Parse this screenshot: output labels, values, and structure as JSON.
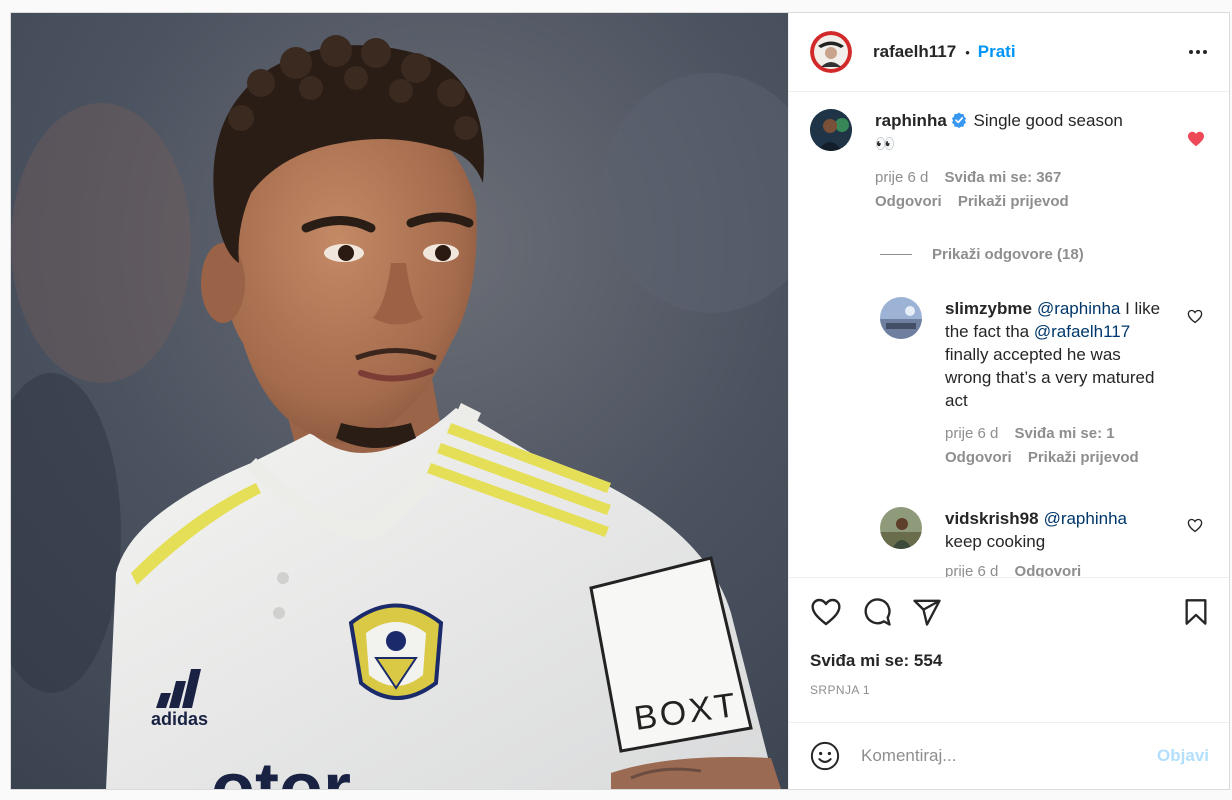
{
  "header": {
    "username": "rafaelh117",
    "separator": "•",
    "follow_label": "Prati"
  },
  "caption_comment": {
    "username": "raphinha",
    "text": "Single good season",
    "emoji": "👀",
    "time": "prije 6 d",
    "likes": "Sviđa mi se: 367",
    "reply_label": "Odgovori",
    "translate_label": "Prikaži prijevod",
    "liked": true
  },
  "view_replies": "Prikaži odgovore (18)",
  "replies": [
    {
      "username": "slimzybme",
      "mention": "@raphinha",
      "text_1": " I like the fact tha ",
      "mention_2": "@rafaelh117",
      "text_2": " finally accepted he was wrong that’s a very matured act",
      "time": "prije 6 d",
      "likes": "Sviđa mi se: 1",
      "reply_label": "Odgovori",
      "translate_label": "Prikaži prijevod"
    },
    {
      "username": "vidskrish98",
      "mention": "@raphinha",
      "text_1": " keep cooking",
      "time": "prije 6 d",
      "reply_label": "Odgovori"
    }
  ],
  "actions": {
    "likes": "Sviđa mi se: 554",
    "date": "SRPNJA 1"
  },
  "comment_box": {
    "placeholder": "Komentiraj...",
    "post_label": "Objavi"
  },
  "photo": {
    "jersey_sponsor": "BOXT",
    "jersey_text": "otor",
    "brand_mark": "adidas"
  },
  "colors": {
    "accent": "#0095f6",
    "heart_red": "#ed4956",
    "post_disabled": "#b2dffc",
    "muted": "#8e8e8e",
    "mention": "#00376b"
  },
  "icons": [
    "more-icon",
    "verified-icon",
    "heart-icon",
    "comment-icon",
    "share-icon",
    "save-icon",
    "emoji-icon"
  ]
}
